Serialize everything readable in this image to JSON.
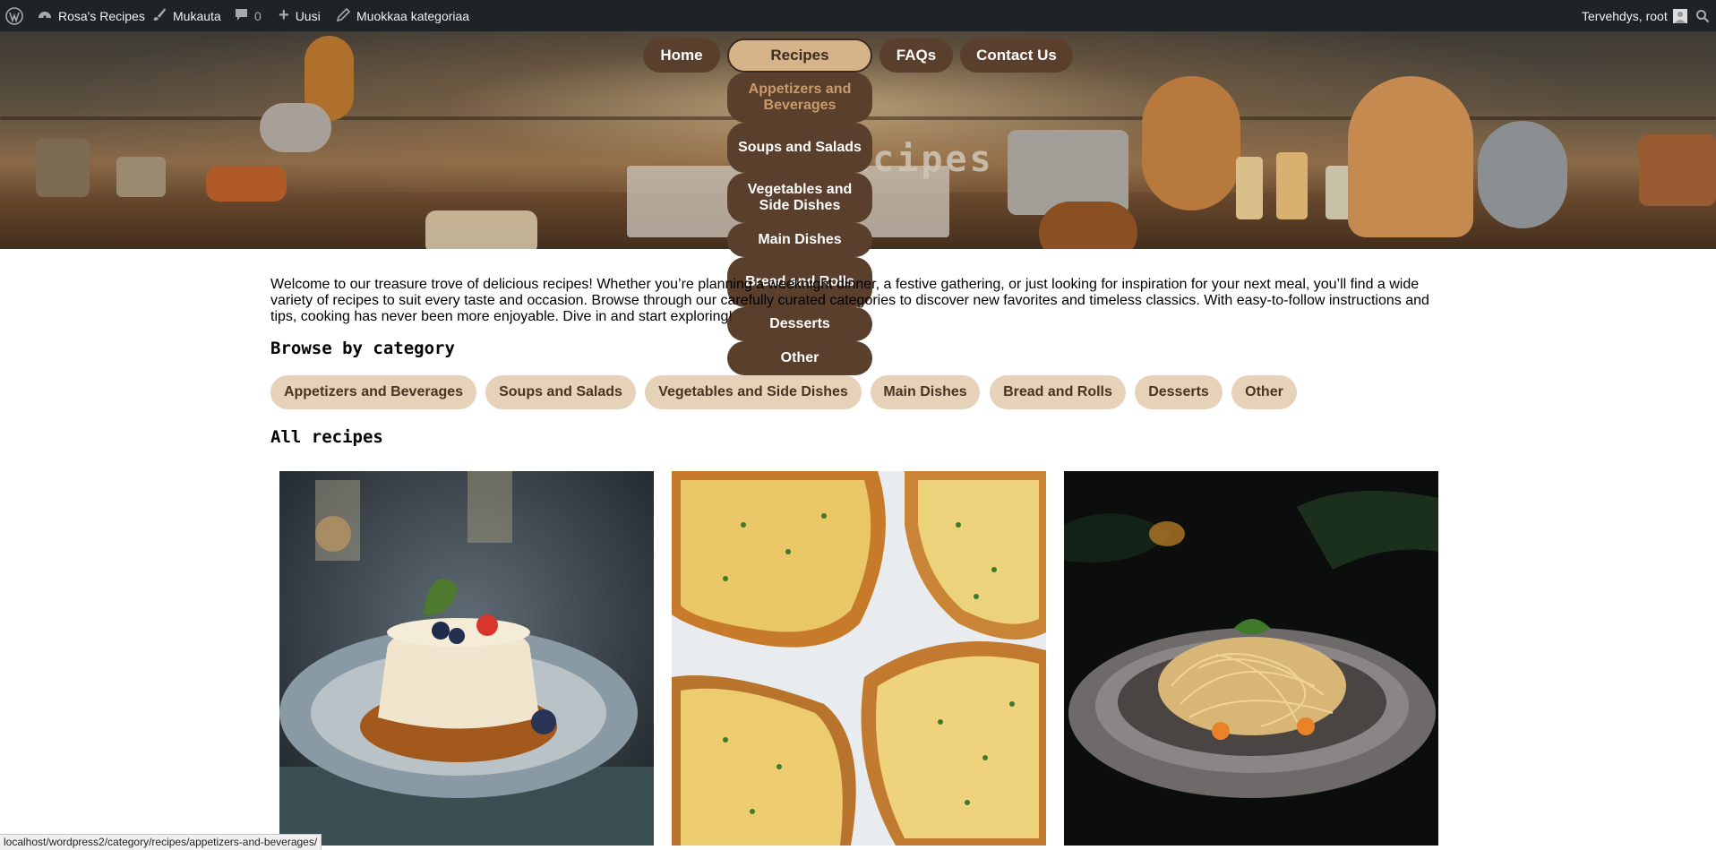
{
  "adminbar": {
    "site_name": "Rosa's Recipes",
    "customize": "Mukauta",
    "comments_count": "0",
    "new": "Uusi",
    "edit": "Muokkaa kategoriaa",
    "greeting": "Tervehdys, root"
  },
  "nav": {
    "home": "Home",
    "recipes": "Recipes",
    "faqs": "FAQs",
    "contact": "Contact Us",
    "dropdown": [
      "Appetizers and Beverages",
      "Soups and Salads",
      "Vegetables and Side Dishes",
      "Main Dishes",
      "Bread and Rolls",
      "Desserts",
      "Other"
    ]
  },
  "hero": {
    "title": "Recipes"
  },
  "intro": "Welcome to our treasure trove of delicious recipes! Whether you’re planning a weeknight dinner, a festive gathering, or just looking for inspiration for your next meal, you’ll find a wide variety of recipes to suit every taste and occasion. Browse through our carefully curated categories to discover new favorites and timeless classics. With easy-to-follow instructions and tips, cooking has never been more enjoyable. Dive in and start exploring!",
  "browse_heading": "Browse by category",
  "categories": [
    "Appetizers and Beverages",
    "Soups and Salads",
    "Vegetables and Side Dishes",
    "Main Dishes",
    "Bread and Rolls",
    "Desserts",
    "Other"
  ],
  "all_heading": "All recipes",
  "status_url": "localhost/wordpress2/category/recipes/appetizers-and-beverages/",
  "colors": {
    "accent": "#5a3f2d",
    "pill_light": "#e6d2b8",
    "admin_bg": "#1d2327"
  }
}
